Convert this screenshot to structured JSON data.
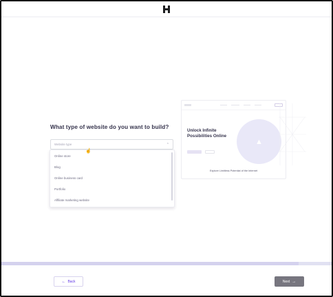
{
  "header": {
    "logo_icon": "hostinger-logo-icon"
  },
  "question": {
    "title": "What type of website do you want to build?"
  },
  "select": {
    "placeholder": "Website type",
    "chevron_icon": "chevron-up-icon"
  },
  "options": [
    {
      "label": "Online store"
    },
    {
      "label": "Blog"
    },
    {
      "label": "Online business card"
    },
    {
      "label": "Portfolio"
    },
    {
      "label": "Affiliate marketing website"
    }
  ],
  "preview": {
    "headline": "Unlock Infinite Possibilities Online",
    "caption": "Explore Limitless Potential of the Internet",
    "image_icon": "image-icon"
  },
  "progress": {
    "value": 0.9
  },
  "footer": {
    "back_label": "Back",
    "back_icon": "arrow-left-icon",
    "next_label": "Next",
    "next_icon": "arrow-right-icon"
  },
  "colors": {
    "accent": "#673de6",
    "next_disabled": "#77767f",
    "progress_track": "#e1e1f2"
  }
}
